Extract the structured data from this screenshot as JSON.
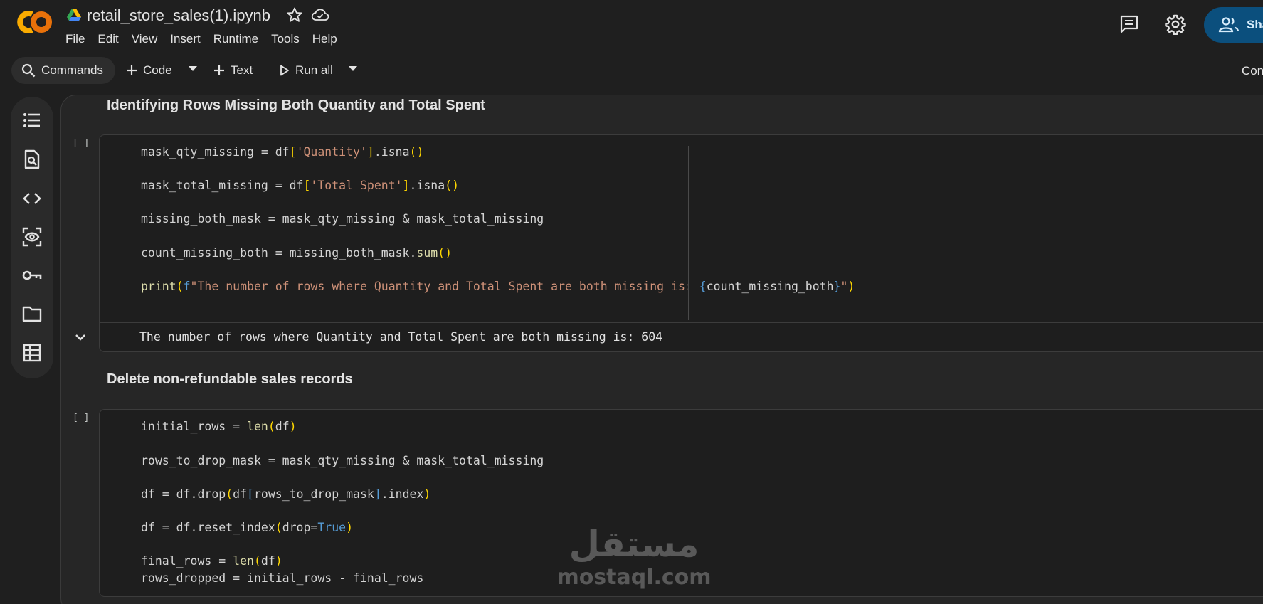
{
  "header": {
    "logo_text": "CO",
    "filename": "retail_store_sales(1).ipynb",
    "menu": [
      "File",
      "Edit",
      "View",
      "Insert",
      "Runtime",
      "Tools",
      "Help"
    ],
    "share_label": "Sha"
  },
  "toolbar": {
    "commands_label": "Commands",
    "code_label": "Code",
    "text_label": "Text",
    "run_all_label": "Run all",
    "right_label": "Con"
  },
  "sidebar": {
    "icons": [
      "table-of-contents-icon",
      "find-in-files-icon",
      "code-snippets-icon",
      "variables-inspector-icon",
      "secrets-key-icon",
      "files-folder-icon",
      "data-table-icon"
    ]
  },
  "notebook": {
    "section1_title": "Identifying Rows Missing Both Quantity and Total Spent",
    "section2_title": "Delete non-refundable sales records",
    "cell_bracket": "[ ]",
    "cell1_output": "The number of rows where Quantity and Total Spent are both missing is: 604"
  },
  "watermark": {
    "arabic": "مستقل",
    "latin": "mostaql.com"
  }
}
